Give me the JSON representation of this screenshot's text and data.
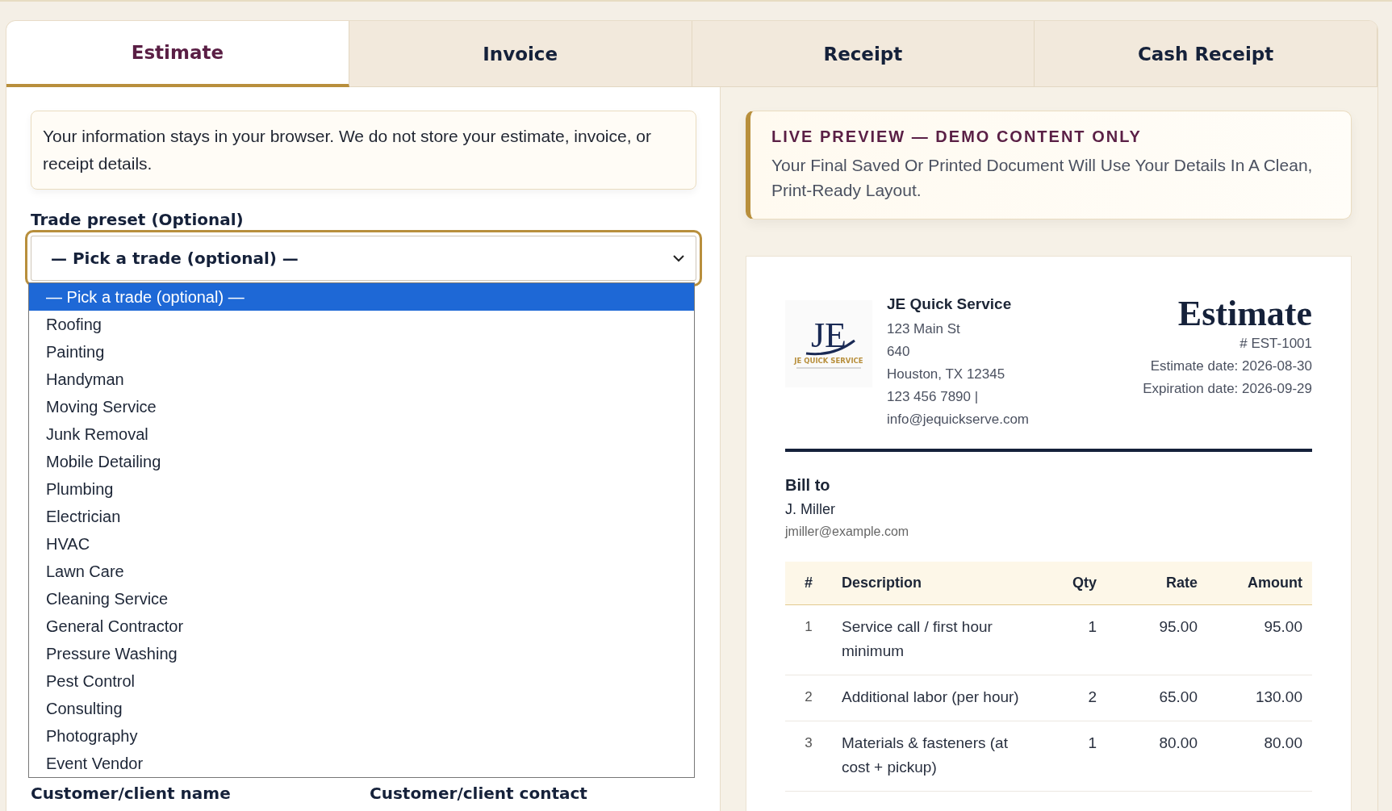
{
  "tabs": [
    {
      "label": "Estimate",
      "selected": true
    },
    {
      "label": "Invoice",
      "selected": false
    },
    {
      "label": "Receipt",
      "selected": false
    },
    {
      "label": "Cash Receipt",
      "selected": false
    }
  ],
  "privacy_notice": "Your information stays in your browser. We do not store your estimate, invoice, or receipt details.",
  "trade_preset": {
    "label": "Trade preset (Optional)",
    "value": "— Pick a trade (optional) —",
    "expanded": true,
    "options": [
      {
        "label": "— Pick a trade (optional) —",
        "selected": true
      },
      {
        "label": "Roofing",
        "selected": false
      },
      {
        "label": "Painting",
        "selected": false
      },
      {
        "label": "Handyman",
        "selected": false
      },
      {
        "label": "Moving Service",
        "selected": false
      },
      {
        "label": "Junk Removal",
        "selected": false
      },
      {
        "label": "Mobile Detailing",
        "selected": false
      },
      {
        "label": "Plumbing",
        "selected": false
      },
      {
        "label": "Electrician",
        "selected": false
      },
      {
        "label": "HVAC",
        "selected": false
      },
      {
        "label": "Lawn Care",
        "selected": false
      },
      {
        "label": "Cleaning Service",
        "selected": false
      },
      {
        "label": "General Contractor",
        "selected": false
      },
      {
        "label": "Pressure Washing",
        "selected": false
      },
      {
        "label": "Pest Control",
        "selected": false
      },
      {
        "label": "Consulting",
        "selected": false
      },
      {
        "label": "Photography",
        "selected": false
      },
      {
        "label": "Event Vendor",
        "selected": false
      }
    ]
  },
  "customer_fields": [
    {
      "label": "Customer/client name"
    },
    {
      "label": "Customer/client contact"
    }
  ],
  "preview_notice": {
    "title": "LIVE PREVIEW — DEMO CONTENT ONLY",
    "text": "Your Final Saved Or Printed Document Will Use Your Details In A Clean, Print-Ready Layout."
  },
  "document": {
    "logo": {
      "monogram": "JE",
      "name": "JE QUICK SERVICE"
    },
    "company": {
      "name": "JE Quick Service",
      "lines": [
        "123 Main St",
        "640",
        "Houston, TX 12345",
        "123 456 7890 |",
        "info@jequickserve.com"
      ]
    },
    "title": "Estimate",
    "number": "# EST-1001",
    "dates": [
      "Estimate date: 2026-08-30",
      "Expiration date: 2026-09-29"
    ],
    "bill_to": {
      "heading": "Bill to",
      "name": "J. Miller",
      "email": "jmiller@example.com"
    },
    "table": {
      "columns": [
        "#",
        "Description",
        "Qty",
        "Rate",
        "Amount"
      ],
      "rows": [
        [
          "1",
          "Service call / first hour minimum",
          "1",
          "95.00",
          "95.00"
        ],
        [
          "2",
          "Additional labor (per hour)",
          "2",
          "65.00",
          "130.00"
        ],
        [
          "3",
          "Materials & fasteners (at cost + pickup)",
          "1",
          "80.00",
          "80.00"
        ]
      ]
    }
  }
}
